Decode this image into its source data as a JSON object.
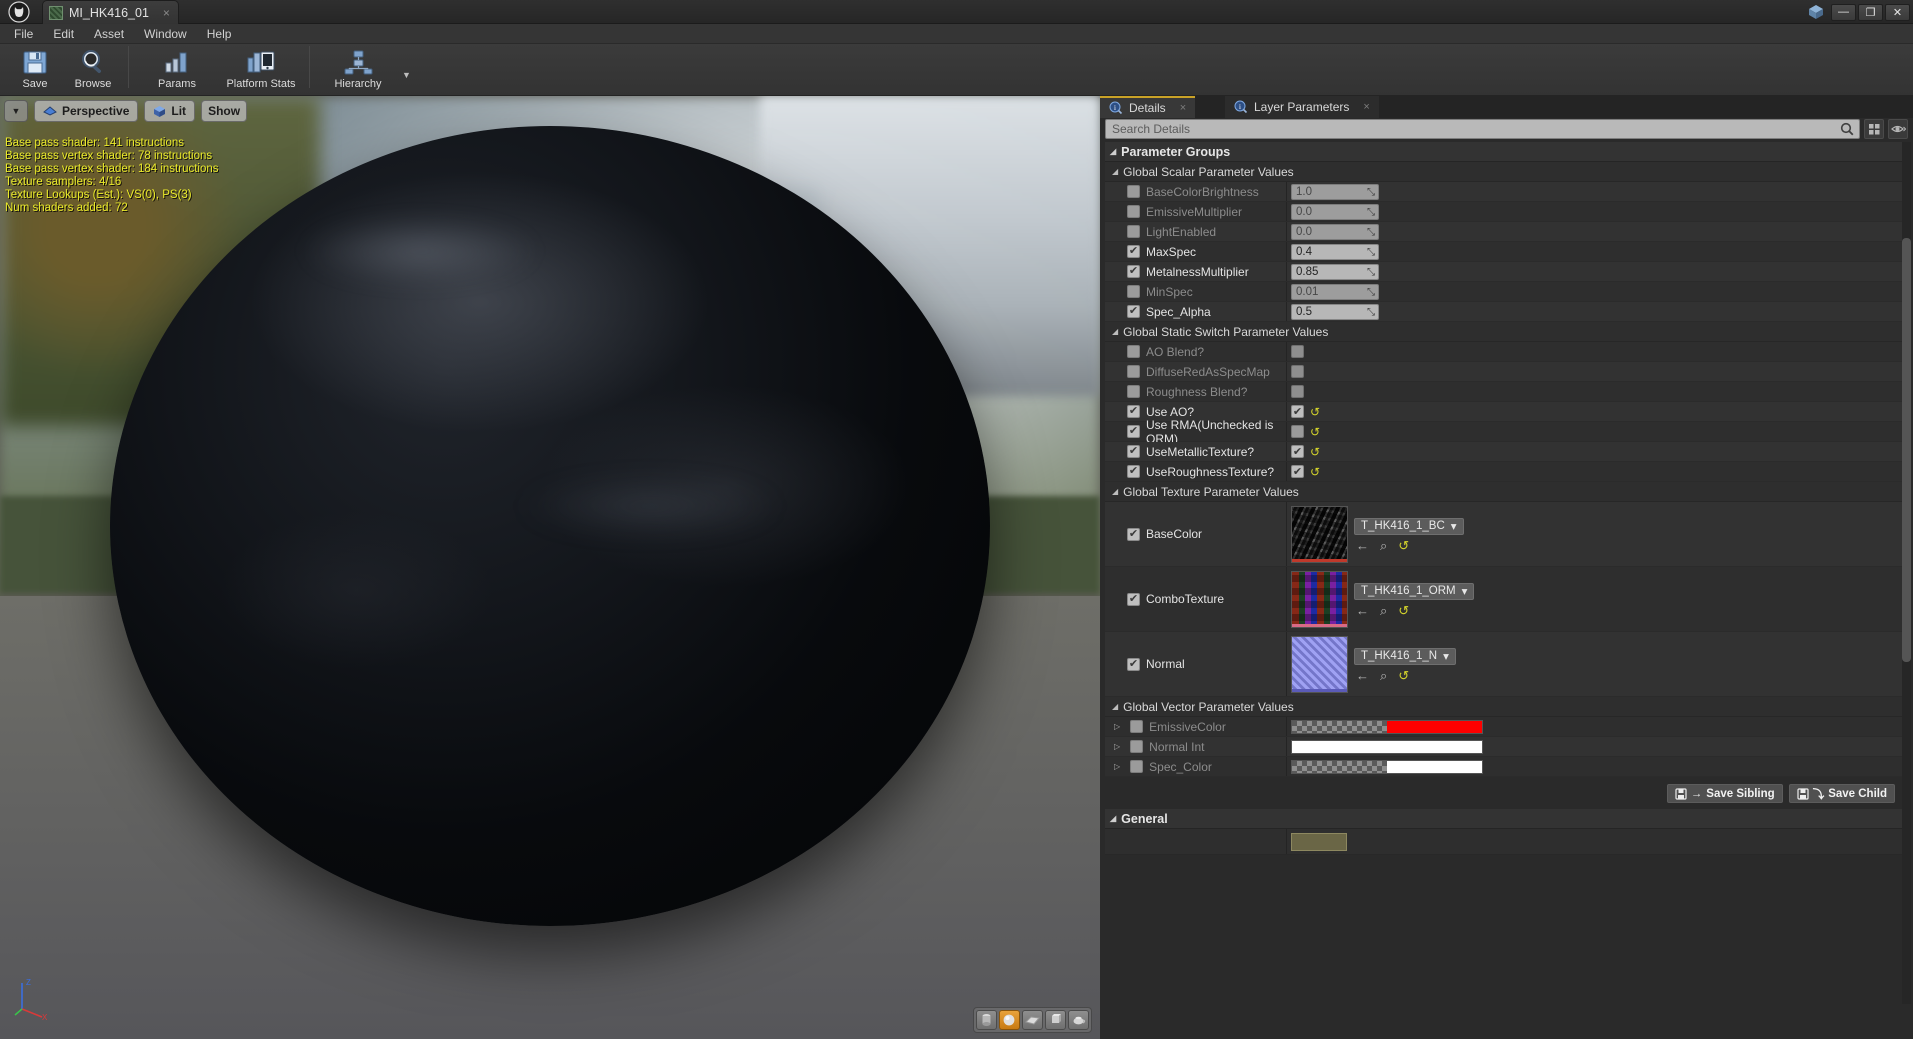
{
  "window": {
    "tab_title": "MI_HK416_01",
    "tab_close": "×",
    "minimize": "—",
    "restore": "❐",
    "close": "✕"
  },
  "menu": {
    "items": [
      "File",
      "Edit",
      "Asset",
      "Window",
      "Help"
    ]
  },
  "toolbar": {
    "buttons": [
      {
        "label": "Save",
        "icon": "save-icon"
      },
      {
        "label": "Browse",
        "icon": "browse-magnifier-icon"
      },
      {
        "label": "Params",
        "icon": "params-bars-icon"
      },
      {
        "label": "Platform Stats",
        "icon": "platform-stats-icon"
      },
      {
        "label": "Hierarchy",
        "icon": "hierarchy-tree-icon"
      }
    ],
    "hierarchy_caret": "▼"
  },
  "viewport": {
    "caret": "▼",
    "perspective_label": "Perspective",
    "lit_label": "Lit",
    "show_label": "Show",
    "stats": [
      "Base pass shader: 141 instructions",
      "Base pass vertex shader: 78 instructions",
      "Base pass vertex shader: 184 instructions",
      "Texture samplers: 4/16",
      "Texture Lookups (Est.): VS(0), PS(3)",
      "Num shaders added: 72"
    ],
    "axis": {
      "z": "Z",
      "x": "X",
      "y": "Y"
    },
    "shapes": [
      {
        "name": "cylinder",
        "active": false
      },
      {
        "name": "sphere",
        "active": true
      },
      {
        "name": "plane",
        "active": false
      },
      {
        "name": "cube",
        "active": false
      },
      {
        "name": "teapot",
        "active": false
      }
    ]
  },
  "details": {
    "tabs": [
      {
        "label": "Details",
        "active": true,
        "close": "×"
      },
      {
        "label": "Layer Parameters",
        "active": false,
        "close": "×"
      }
    ],
    "search_placeholder": "Search Details",
    "parameter_groups_label": "Parameter Groups",
    "sections": {
      "scalar": {
        "title": "Global Scalar Parameter Values",
        "rows": [
          {
            "name": "BaseColorBrightness",
            "enabled": false,
            "value": "1.0"
          },
          {
            "name": "EmissiveMultiplier",
            "enabled": false,
            "value": "0.0"
          },
          {
            "name": "LightEnabled",
            "enabled": false,
            "value": "0.0"
          },
          {
            "name": "MaxSpec",
            "enabled": true,
            "value": "0.4"
          },
          {
            "name": "MetalnessMultiplier",
            "enabled": true,
            "value": "0.85"
          },
          {
            "name": "MinSpec",
            "enabled": false,
            "value": "0.01"
          },
          {
            "name": "Spec_Alpha",
            "enabled": true,
            "value": "0.5"
          }
        ]
      },
      "static_switch": {
        "title": "Global Static Switch Parameter Values",
        "rows": [
          {
            "name": "AO Blend?",
            "enabled": false,
            "checked": false,
            "reset": false
          },
          {
            "name": "DiffuseRedAsSpecMap",
            "enabled": false,
            "checked": false,
            "reset": false
          },
          {
            "name": "Roughness Blend?",
            "enabled": false,
            "checked": false,
            "reset": false
          },
          {
            "name": "Use AO?",
            "enabled": true,
            "checked": true,
            "reset": true
          },
          {
            "name": "Use RMA(Unchecked is ORM)",
            "enabled": true,
            "checked": false,
            "reset": true
          },
          {
            "name": "UseMetallicTexture?",
            "enabled": true,
            "checked": true,
            "reset": true
          },
          {
            "name": "UseRoughnessTexture?",
            "enabled": true,
            "checked": true,
            "reset": true
          }
        ]
      },
      "texture": {
        "title": "Global Texture Parameter Values",
        "rows": [
          {
            "name": "BaseColor",
            "enabled": true,
            "asset": "T_HK416_1_BC",
            "thumb": "thumb-bc",
            "accent": "#c0392b"
          },
          {
            "name": "ComboTexture",
            "enabled": true,
            "asset": "T_HK416_1_ORM",
            "thumb": "thumb-orm",
            "accent": "#d96a86"
          },
          {
            "name": "Normal",
            "enabled": true,
            "asset": "T_HK416_1_N",
            "thumb": "thumb-n",
            "accent": "#5b5bb8"
          }
        ],
        "dropdown_caret": "▾",
        "action_icons": [
          "back-arrow-icon",
          "browse-magnifier-icon",
          "reset-arrow-icon"
        ]
      },
      "vector": {
        "title": "Global Vector Parameter Values",
        "rows": [
          {
            "name": "EmissiveColor",
            "enabled": false,
            "swatch": "#fe0000",
            "has_checker": true
          },
          {
            "name": "Normal Int",
            "enabled": false,
            "swatch": "#ffffff",
            "has_checker": false
          },
          {
            "name": "Spec_Color",
            "enabled": false,
            "swatch": "#ffffff",
            "has_checker": true
          }
        ],
        "expand_caret": "▷"
      },
      "general": {
        "title": "General"
      }
    },
    "save_sibling_label": "Save Sibling",
    "save_child_label": "Save Child",
    "sibling_glyph": "→",
    "child_glyph": "⤵",
    "collapse_tri": "◢"
  }
}
